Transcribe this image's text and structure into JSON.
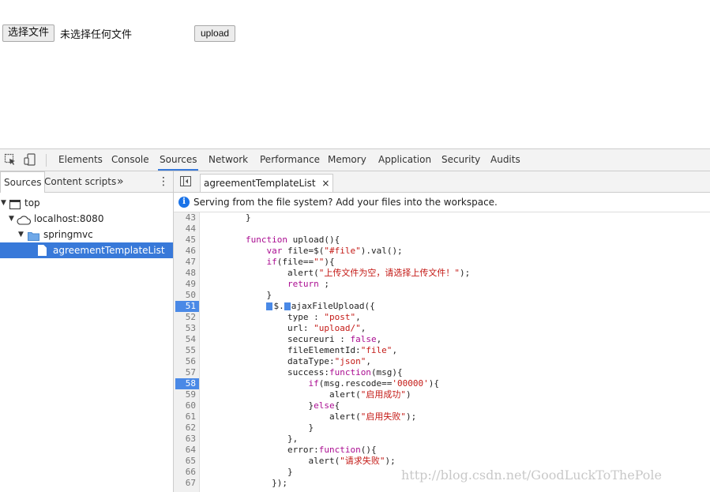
{
  "page": {
    "choose_file_label": "选择文件",
    "file_status": "未选择任何文件",
    "upload_label": "upload"
  },
  "devtools": {
    "tabs": [
      "Elements",
      "Console",
      "Sources",
      "Network",
      "Performance",
      "Memory",
      "Application",
      "Security",
      "Audits"
    ],
    "active_tab": "Sources",
    "left_tabs": {
      "sources": "Sources",
      "content_scripts": "Content scripts",
      "more": "»",
      "menu": "⋮"
    },
    "tree": {
      "top": "top",
      "host": "localhost:8080",
      "folder": "springmvc",
      "file": "agreementTemplateList"
    },
    "file_tab": {
      "label": "agreementTemplateList",
      "close": "×"
    },
    "info_message": "Serving from the file system? Add your files into the workspace.",
    "line_numbers": [
      "43",
      "44",
      "45",
      "46",
      "47",
      "48",
      "49",
      "50",
      "51",
      "52",
      "53",
      "54",
      "55",
      "56",
      "57",
      "58",
      "59",
      "60",
      "61",
      "62",
      "63",
      "64",
      "65",
      "66",
      "67"
    ],
    "breakpoint_lines": [
      "51",
      "58"
    ],
    "code": {
      "l43": "        }",
      "l45_kw": "function",
      "l45_rest": " upload(){",
      "l46_kw": "var",
      "l46_a": " file=$(",
      "l46_str": "\"#file\"",
      "l46_b": ").val();",
      "l47_kw": "if",
      "l47_a": "(file==",
      "l47_str": "\"\"",
      "l47_b": "){",
      "l48_a": "alert(",
      "l48_str": "\"上传文件为空，请选择上传文件！\"",
      "l48_b": ");",
      "l49_kw": "return",
      "l49_b": " ;",
      "l50": "}",
      "l51_a": "$.",
      "l51_b": "ajaxFileUpload({",
      "l52_a": "type : ",
      "l52_str": "\"post\"",
      "l52_b": ",",
      "l53_a": "url: ",
      "l53_str": "\"upload/\"",
      "l53_b": ",",
      "l54_a": "secureuri : ",
      "l54_kw": "false",
      "l54_b": ",",
      "l55_a": "fileElementId:",
      "l55_str": "\"file\"",
      "l55_b": ",",
      "l56_a": "dataType:",
      "l56_str": "\"json\"",
      "l56_b": ",",
      "l57_a": "success:",
      "l57_kw": "function",
      "l57_b": "(msg){",
      "l58_kw": "if",
      "l58_a": "(msg.rescode==",
      "l58_str": "'00000'",
      "l58_b": "){",
      "l59_a": "alert(",
      "l59_str": "\"启用成功\"",
      "l59_b": ")",
      "l60_a": "}",
      "l60_kw": "else",
      "l60_b": "{",
      "l61_a": "alert(",
      "l61_str": "\"启用失败\"",
      "l61_b": ");",
      "l62": "}",
      "l63": "},",
      "l64_a": "error:",
      "l64_kw": "function",
      "l64_b": "(){",
      "l65_a": "alert(",
      "l65_str": "\"请求失败\"",
      "l65_b": ");",
      "l66": "}",
      "l67": "});"
    }
  },
  "watermark": "http://blog.csdn.net/GoodLuckToThePole",
  "colors": {
    "accent": "#3879d9",
    "keyword": "#aa0d91",
    "string": "#c41a16",
    "breakpoint": "#4a89e6"
  }
}
